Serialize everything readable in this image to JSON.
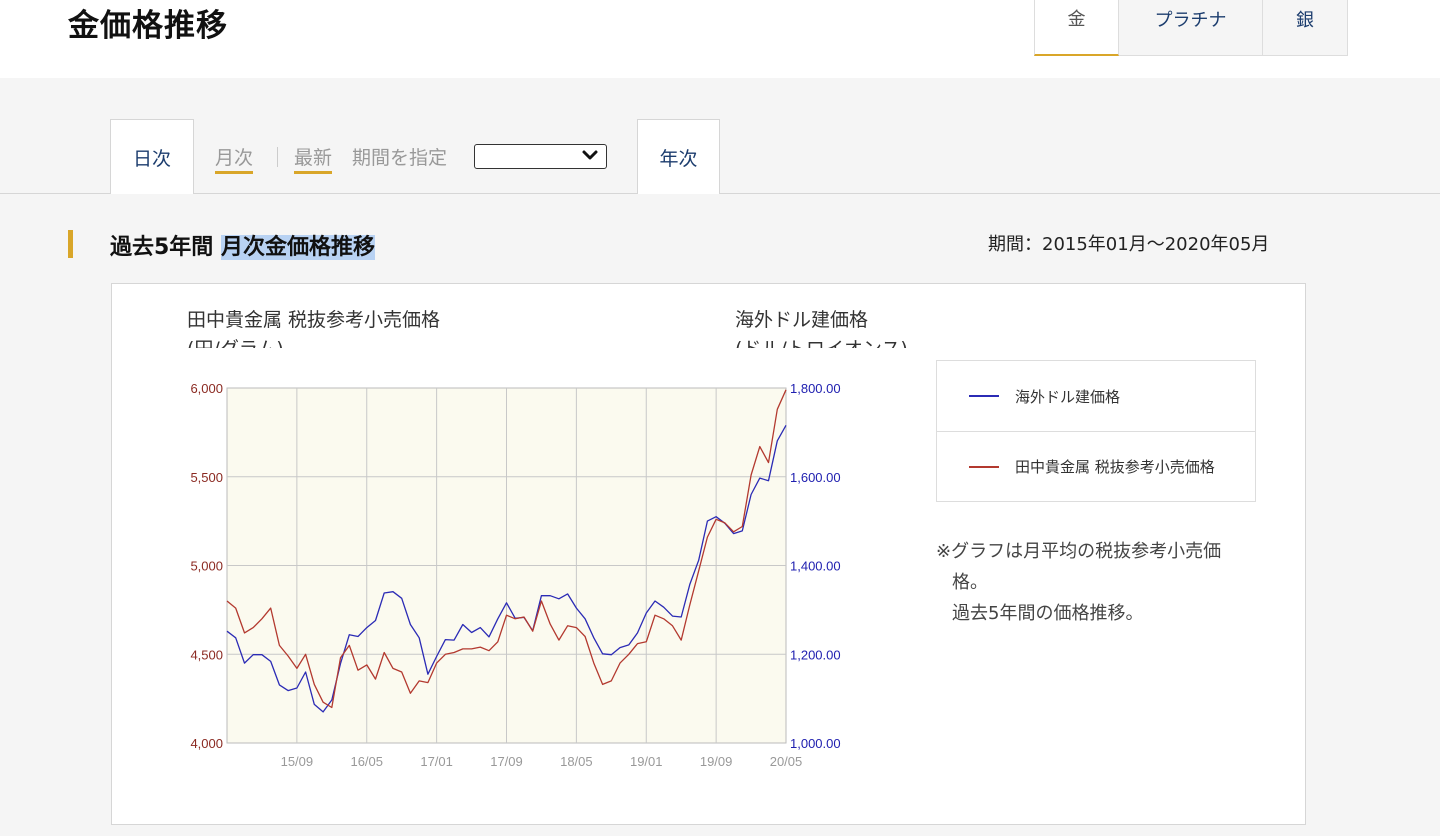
{
  "header": {
    "title": "金価格推移"
  },
  "metal_tabs": [
    {
      "label": "金",
      "active": true
    },
    {
      "label": "プラチナ",
      "active": false
    },
    {
      "label": "銀",
      "active": false
    }
  ],
  "subnav": {
    "daily": "日次",
    "monthly": "月次",
    "latest": "最新",
    "period_label": "期間を指定",
    "period_select_value": "",
    "yearly": "年次"
  },
  "section": {
    "title_prefix": "過去5年間",
    "title_highlight": "月次金価格推移",
    "period": "期間：2015年01月〜2020年05月"
  },
  "chart_titles": {
    "left": "田中貴金属 税抜参考小売価格",
    "left_unit": "(円/グラム)",
    "right": "海外ドル建価格",
    "right_unit": "(ドル/トロイオンス)"
  },
  "legend": [
    {
      "label": "海外ドル建価格",
      "color": "#2b2bb5"
    },
    {
      "label": "田中貴金属 税抜参考小売価格",
      "color": "#b3392f"
    }
  ],
  "note": {
    "line1": "※グラフは月平均の税抜参考小売価",
    "line2": "格。",
    "line3": "過去5年間の価格推移。"
  },
  "colors": {
    "accent": "#d9a629",
    "link": "#1c3d6e",
    "plot_bg": "#fbfaef",
    "left_axis": "#8b2a22",
    "right_axis": "#2020b0"
  },
  "chart_data": {
    "type": "line",
    "x_ticks": [
      "15/09",
      "16/05",
      "17/01",
      "17/09",
      "18/05",
      "19/01",
      "19/09",
      "20/05"
    ],
    "y_left": {
      "ticks": [
        "6,000",
        "5,500",
        "5,000",
        "4,500",
        "4,000"
      ],
      "min": 4000,
      "max": 6000
    },
    "y_right": {
      "ticks": [
        "1,800.00",
        "1,600.00",
        "1,400.00",
        "1,200.00",
        "1,000.00"
      ],
      "min": 1000,
      "max": 1800
    },
    "series": [
      {
        "name": "海外ドル建価格",
        "axis": "right",
        "color": "#2b2bb5",
        "values": [
          1252,
          1237,
          1180,
          1199,
          1199,
          1184,
          1131,
          1118,
          1124,
          1160,
          1087,
          1070,
          1097,
          1179,
          1244,
          1240,
          1260,
          1276,
          1338,
          1341,
          1326,
          1267,
          1237,
          1155,
          1195,
          1233,
          1232,
          1267,
          1249,
          1260,
          1239,
          1280,
          1316,
          1281,
          1283,
          1253,
          1332,
          1332,
          1325,
          1336,
          1304,
          1280,
          1237,
          1201,
          1199,
          1215,
          1221,
          1248,
          1293,
          1320,
          1306,
          1286,
          1284,
          1358,
          1412,
          1500,
          1510,
          1495,
          1472,
          1478,
          1560,
          1597,
          1591,
          1681,
          1716
        ]
      },
      {
        "name": "田中貴金属 税抜参考小売価格",
        "axis": "left",
        "color": "#b3392f",
        "values": [
          4800,
          4760,
          4620,
          4650,
          4700,
          4760,
          4550,
          4490,
          4420,
          4500,
          4330,
          4230,
          4200,
          4480,
          4550,
          4410,
          4440,
          4360,
          4510,
          4420,
          4400,
          4280,
          4350,
          4340,
          4450,
          4500,
          4510,
          4530,
          4530,
          4540,
          4520,
          4570,
          4720,
          4700,
          4710,
          4630,
          4800,
          4670,
          4580,
          4660,
          4650,
          4600,
          4450,
          4330,
          4350,
          4450,
          4500,
          4560,
          4570,
          4720,
          4700,
          4660,
          4580,
          4780,
          4970,
          5160,
          5260,
          5240,
          5190,
          5220,
          5510,
          5670,
          5580,
          5880,
          5990
        ]
      }
    ],
    "grid": true
  }
}
